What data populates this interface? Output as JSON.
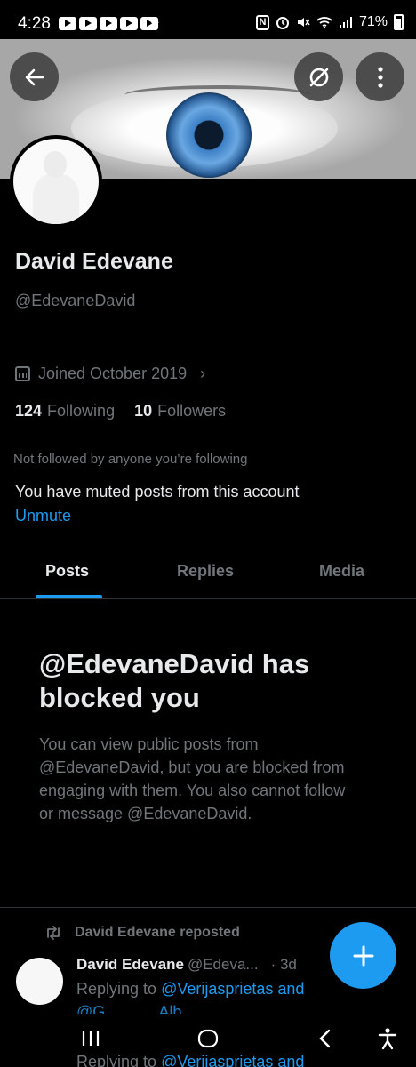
{
  "status_bar": {
    "time": "4:28",
    "battery": "71%",
    "misc_icon": "⚘",
    "icons": [
      "youtube-icon",
      "youtube-icon",
      "youtube-icon",
      "youtube-icon",
      "youtube-icon",
      "nfc-icon",
      "alarm-icon",
      "mute-icon",
      "wifi-icon",
      "signal-icon",
      "battery-icon"
    ]
  },
  "header": {
    "back_icon": "arrow-left-icon",
    "grok_icon": "grok-icon",
    "more_icon": "more-vertical-icon"
  },
  "profile": {
    "display_name": "David Edevane",
    "handle": "@EdevaneDavid",
    "joined": "Joined October 2019",
    "following_count": "124",
    "following_label": "Following",
    "followers_count": "10",
    "followers_label": "Followers",
    "not_followed_text": "Not followed by anyone you’re following",
    "muted_text": "You have muted posts from this account",
    "unmute_label": "Unmute"
  },
  "tabs": [
    {
      "label": "Posts",
      "active": true
    },
    {
      "label": "Replies",
      "active": false
    },
    {
      "label": "Media",
      "active": false
    }
  ],
  "blocked": {
    "title": "@EdevaneDavid has blocked you",
    "description": "You can view public posts from @EdevaneDavid, but you are blocked from engaging with them. You also cannot follow or message @EdevaneDavid."
  },
  "post": {
    "repost_label": "David Edevane reposted",
    "author_name": "David Edevane",
    "author_handle": "@Edeva...",
    "time": "· 3d",
    "replying_prefix": "Replying to",
    "replying_to": "@Verijasprietas and",
    "replying_line2": "@G______Alb______",
    "replying_peek_prefix": "Replying to",
    "replying_peek": "@Verijasprietas and"
  },
  "colors": {
    "background": "#000000",
    "accent": "#1d9bf0",
    "text_primary": "#e7e9ea",
    "text_secondary": "#71767b",
    "divider": "#2f3336"
  }
}
